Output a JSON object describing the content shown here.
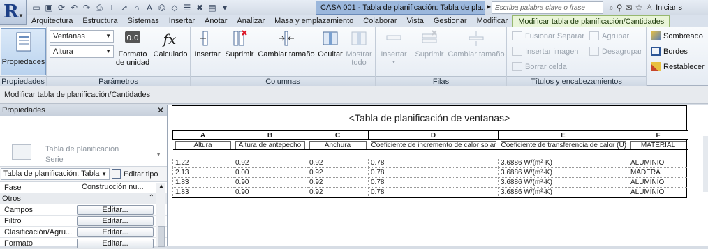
{
  "app": {
    "logo_letter": "R",
    "document_title": "CASA 001 - Tabla de planificación: Tabla de pla...",
    "search_placeholder": "Escriba palabra clave o frase",
    "sign_in": "Iniciar s"
  },
  "menu_tabs": [
    "Arquitectura",
    "Estructura",
    "Sistemas",
    "Insertar",
    "Anotar",
    "Analizar",
    "Masa y emplazamiento",
    "Colaborar",
    "Vista",
    "Gestionar",
    "Modificar",
    "Modificar tabla de planificación/Cantidades"
  ],
  "active_tab_index": 11,
  "ribbon": {
    "propiedades": {
      "button": "Propiedades",
      "title": "Propiedades"
    },
    "parametros": {
      "select1": "Ventanas",
      "select2": "Altura",
      "formato": "Formato de unidad",
      "calculado": "Calculado",
      "title": "Parámetros"
    },
    "columnas": {
      "insertar": "Insertar",
      "suprimir": "Suprimir",
      "cambiar": "Cambiar tamaño",
      "ocultar": "Ocultar",
      "mostrar": "Mostrar todo",
      "title": "Columnas"
    },
    "filas": {
      "insertar": "Insertar",
      "suprimir": "Suprimir",
      "cambiar": "Cambiar tamaño",
      "title": "Filas"
    },
    "titulos": {
      "fusionar": "Fusionar Separar",
      "agrupar": "Agrupar",
      "insertar_imagen": "Insertar imagen",
      "desagrupar": "Desagrupar",
      "borrar_celda": "Borrar celda",
      "title": "Títulos y encabezamientos"
    },
    "apariencia": {
      "sombreado": "Sombreado",
      "bordes": "Bordes",
      "restablecer": "Restablecer"
    }
  },
  "context_bar": "Modificar tabla de planificación/Cantidades",
  "properties": {
    "header": "Propiedades",
    "type_name_line1": "Tabla de planificación",
    "type_name_line2": "Serie",
    "type_selector": "Tabla de planificación: Tabla",
    "edit_type": "Editar tipo",
    "fase_label": "Fase",
    "fase_value": "Construcción nu...",
    "group_otros": "Otros",
    "rows": [
      {
        "label": "Campos",
        "button": "Editar..."
      },
      {
        "label": "Filtro",
        "button": "Editar..."
      },
      {
        "label": "Clasificación/Agru...",
        "button": "Editar..."
      },
      {
        "label": "Formato",
        "button": "Editar..."
      }
    ]
  },
  "schedule": {
    "title": "<Tabla de planificación de ventanas>",
    "letters": [
      "A",
      "B",
      "C",
      "D",
      "E",
      "F"
    ],
    "headers": [
      "Altura",
      "Altura de antepecho",
      "Anchura",
      "Coeficiente de incremento de calor solar",
      "Coeficiente de transferencia de calor (U)",
      "MATERIAL"
    ],
    "rows": [
      [
        "1.22",
        "0.92",
        "0.92",
        "0.78",
        "3.6886 W/(m²·K)",
        "ALUMINIO"
      ],
      [
        "2.13",
        "0.00",
        "0.92",
        "0.78",
        "3.6886 W/(m²·K)",
        "MADERA"
      ],
      [
        "1.83",
        "0.90",
        "0.92",
        "0.78",
        "3.6886 W/(m²·K)",
        "ALUMINIO"
      ],
      [
        "1.83",
        "0.90",
        "0.92",
        "0.78",
        "3.6886 W/(m²·K)",
        "ALUMINIO"
      ]
    ]
  }
}
